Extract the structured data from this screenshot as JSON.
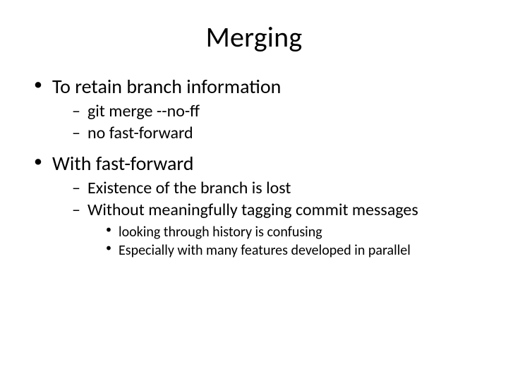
{
  "title": "Merging",
  "bullets": [
    {
      "text": "To retain branch information",
      "sub": [
        {
          "text": "git merge --no-ff"
        },
        {
          "text": "no fast-forward"
        }
      ]
    },
    {
      "text": "With fast-forward",
      "sub": [
        {
          "text": "Existence of the branch is lost"
        },
        {
          "text": "Without meaningfully tagging commit messages",
          "sub": [
            {
              "text": "looking through history is confusing"
            },
            {
              "text": "Especially with many features developed in parallel"
            }
          ]
        }
      ]
    }
  ]
}
